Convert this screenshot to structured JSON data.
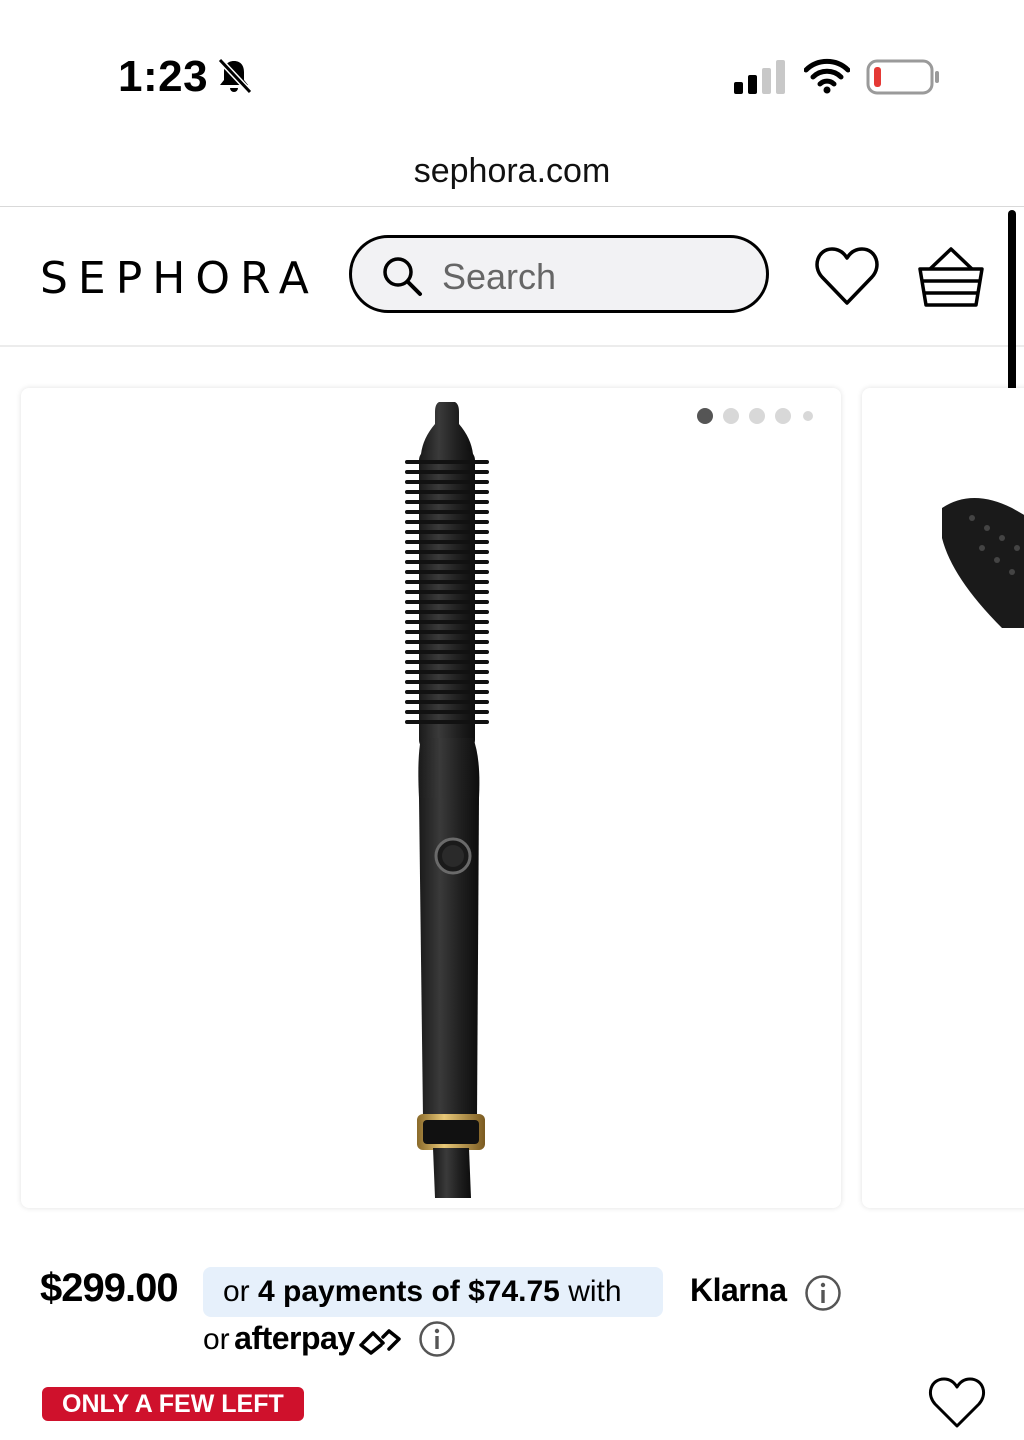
{
  "status_bar": {
    "time": "1:23",
    "icons": [
      "bell-slash-icon",
      "cellular-signal-icon",
      "wifi-icon",
      "battery-low-icon"
    ],
    "battery_color": "#e53935"
  },
  "browser": {
    "url": "sephora.com"
  },
  "header": {
    "logo": "SEPHORA",
    "search_placeholder": "Search",
    "icons": [
      "search-icon",
      "heart-icon",
      "basket-icon"
    ]
  },
  "product": {
    "carousel_total_dots": 5,
    "carousel_active_index": 0,
    "image": "black-heated-round-brush",
    "price": "$299.00",
    "klarna": {
      "prefix": "or",
      "bold": "4 payments of $74.75",
      "suffix": "with",
      "provider": "Klarna"
    },
    "afterpay": {
      "prefix": "or",
      "provider": "afterpay"
    },
    "stock_badge": "ONLY A FEW LEFT"
  },
  "colors": {
    "accent_red": "#cf112c",
    "klarna_pill": "#e6f0fb",
    "text": "#000000"
  }
}
